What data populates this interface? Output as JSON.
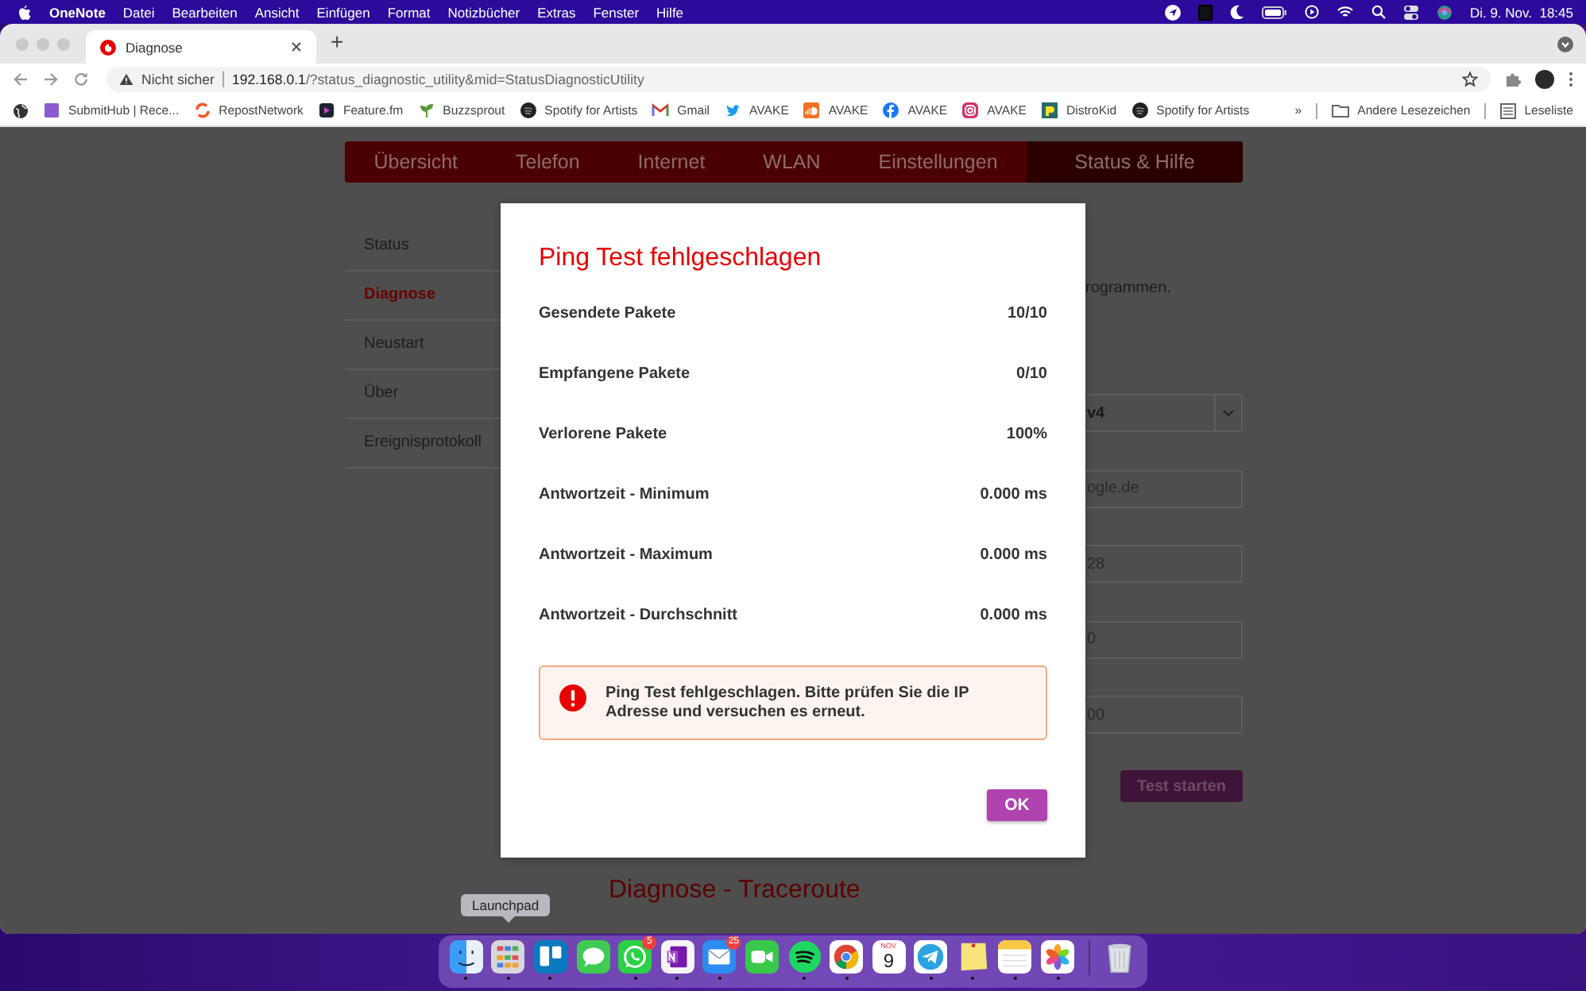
{
  "menubar": {
    "app": "OneNote",
    "menus": [
      "Datei",
      "Bearbeiten",
      "Ansicht",
      "Einfügen",
      "Format",
      "Notizbücher",
      "Extras",
      "Fenster",
      "Hilfe"
    ],
    "clock": "Di. 9. Nov.  18:45"
  },
  "browser": {
    "tab": {
      "title": "Diagnose"
    },
    "new_tab": "+",
    "address": {
      "security": "Nicht sicher",
      "host": "192.168.0.1",
      "path": "/?status_diagnostic_utility&mid=StatusDiagnosticUtility"
    },
    "bookmarks": [
      {
        "kind": "submithub",
        "label": "SubmitHub | Rece..."
      },
      {
        "kind": "repost",
        "label": "RepostNetwork"
      },
      {
        "kind": "featurefm",
        "label": "Feature.fm"
      },
      {
        "kind": "buzzsprout",
        "label": "Buzzsprout"
      },
      {
        "kind": "spotify",
        "label": "Spotify for Artists"
      },
      {
        "kind": "gmail",
        "label": "Gmail"
      },
      {
        "kind": "twitter",
        "label": "AVAKE"
      },
      {
        "kind": "soundcloud",
        "label": "AVAKE"
      },
      {
        "kind": "facebook",
        "label": "AVAKE"
      },
      {
        "kind": "instagram",
        "label": "AVAKE"
      },
      {
        "kind": "distrokid",
        "label": "DistroKid"
      },
      {
        "kind": "spotify",
        "label": "Spotify for Artists"
      }
    ],
    "more": "»",
    "other_bookmarks": "Andere Lesezeichen",
    "reading_list": "Leseliste"
  },
  "page": {
    "nav": [
      {
        "label": "Übersicht",
        "selected": false
      },
      {
        "label": "Telefon",
        "selected": false
      },
      {
        "label": "Internet",
        "selected": false
      },
      {
        "label": "WLAN",
        "selected": false
      },
      {
        "label": "Einstellungen",
        "selected": false
      },
      {
        "label": "Status & Hilfe",
        "selected": true
      }
    ],
    "sidebar": [
      {
        "label": "Status",
        "selected": false
      },
      {
        "label": "Diagnose",
        "selected": true
      },
      {
        "label": "Neustart",
        "selected": false
      },
      {
        "label": "Über",
        "selected": false
      },
      {
        "label": "Ereignisprotokoll",
        "selected": false
      }
    ],
    "intro_text": "rogrammen.",
    "fields": [
      {
        "kind": "select",
        "value": "v4"
      },
      {
        "kind": "input",
        "value": "ogle.de"
      },
      {
        "kind": "input",
        "value": "28"
      },
      {
        "kind": "input",
        "value": "0"
      },
      {
        "kind": "input",
        "value": "00"
      }
    ],
    "start_button": "Test starten",
    "section_title": "Diagnose - Traceroute"
  },
  "modal": {
    "title": "Ping Test fehlgeschlagen",
    "rows": [
      {
        "label": "Gesendete Pakete",
        "value": "10/10"
      },
      {
        "label": "Empfangene Pakete",
        "value": "0/10"
      },
      {
        "label": "Verlorene Pakete",
        "value": "100%"
      },
      {
        "label": "Antwortzeit - Minimum",
        "value": "0.000 ms"
      },
      {
        "label": "Antwortzeit - Maximum",
        "value": "0.000 ms"
      },
      {
        "label": "Antwortzeit - Durchschnitt",
        "value": "0.000 ms"
      }
    ],
    "alert": "Ping Test fehlgeschlagen. Bitte prüfen Sie die IP Adresse und versuchen es erneut.",
    "button": "OK"
  },
  "dock": {
    "tooltip": "Launchpad",
    "apps": [
      {
        "kind": "finder",
        "running": true
      },
      {
        "kind": "launchpad",
        "running": true
      },
      {
        "kind": "trello",
        "running": true
      },
      {
        "kind": "messages",
        "running": false
      },
      {
        "kind": "whatsapp",
        "running": true,
        "badge": "5"
      },
      {
        "kind": "onenote",
        "running": true
      },
      {
        "kind": "mail",
        "running": true,
        "badge": "25"
      },
      {
        "kind": "facetime",
        "running": false
      },
      {
        "kind": "spotify",
        "running": true
      },
      {
        "kind": "chrome",
        "running": true
      },
      {
        "kind": "calendar",
        "running": false,
        "month": "NOV",
        "day": "9"
      },
      {
        "kind": "telegram",
        "running": true
      },
      {
        "kind": "stickies",
        "running": true
      },
      {
        "kind": "notes",
        "running": true
      },
      {
        "kind": "photos",
        "running": true
      },
      {
        "kind": "trash",
        "running": false
      }
    ]
  }
}
